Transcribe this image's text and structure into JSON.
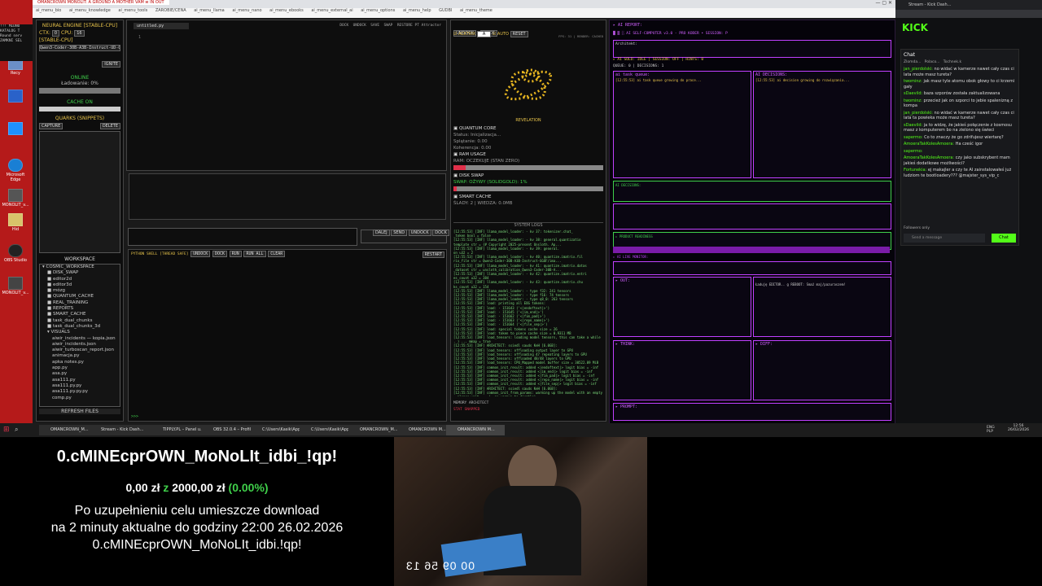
{
  "browser": {
    "tab_title": "OMANCROWN MONOLIT: A GROUND A MOTHER VAM w IN OUT",
    "bookmarks": [
      "ai_menu_bio",
      "ai_menu_knowledge",
      "ai_menu_tools",
      "ZAROBIE/CENA",
      "ai_menu_llama",
      "ai_menu_nano",
      "ai_menu_ebooks",
      "ai_menu_external_ai",
      "ai_menu_options",
      "ai_menu_help",
      "GUDBI",
      "ai_menu_theme"
    ]
  },
  "desktop_icons": [
    "Recy",
    "",
    "",
    "Microsoft Edge",
    "MONOLIT_v...",
    "Hid",
    "OBS Studio",
    "MONOLIT_v..."
  ],
  "left_app": {
    "engine_title": "NEURAL ENGINE [STABLE-CPU]",
    "ctx_label": "CTX:",
    "ctx_value": "0",
    "cpu_label": "CPU:",
    "cpu_value": "16",
    "stable_label": "[STABLE-CPU]",
    "model": "Qwen3-Coder-30B-A3B-Instruct-UD-Q8",
    "ignite": "IGNITE",
    "status": "ONLINE",
    "loading": "Ładowanie: 0%",
    "cache": "CACHE ON",
    "quarks_title": "QUARKS (SNIPPETS)",
    "capture": "CAPTURE",
    "delete": "DELETE",
    "workspace_title": "WORKSPACE",
    "workspace_items": [
      "▾ COSMIC_WORKSPACE",
      "■ DISK_SWAP",
      "■ editor2d",
      "■ editor3d",
      "■ mózg",
      "■ QUANTUM_CACHE",
      "■ REAL_TRAINING",
      "■ REPORTS",
      "■ SMART_CACHE",
      "■ task_dual_chunks",
      "■ task_dual_chunks_3d",
      "▾ VISUALS",
      "aiwir_incidents — kopia.json",
      "aiwir_incidents.json",
      "aiwir_turboscan_report.json",
      "animacja.py",
      "apka notes.py",
      "app.py",
      "asa.py",
      "asa111.py",
      "asa111.py.py",
      "asa111.py.py.py",
      "comp.py"
    ],
    "refresh": "REFRESH FILES",
    "left_text": [
      "!!! MIDNO",
      "KATALOG T",
      "Round serv",
      "ZAMKNI SEL"
    ]
  },
  "editor": {
    "tab": "untitled.py",
    "toolbar": [
      "DOCK",
      "UNDOCK",
      "SAVE",
      "SWAP",
      "RESTORE PT Attractor"
    ],
    "shell_title": "PYTHON SHELL [THREAD SAFE]",
    "shell_btns": [
      "UNDOCK",
      "DOCK",
      "RUN",
      "RUN ALL",
      "CLEAR"
    ],
    "shell_restart": "RESTART",
    "prompt": ">>>",
    "nav_btns": [
      "DALEJ",
      "SEND",
      "UNDOCK",
      "DOCK"
    ]
  },
  "middle": {
    "undock": "UNDOCK",
    "dock": "DOCK",
    "acktrix": "ACKTRIX",
    "acktrix_val": "A",
    "auto": "AUTO",
    "reset": "RESET",
    "fps": "FPS: 31 | RENDER: CACHED",
    "revelation": "REVELATION",
    "quantum_core": "QUANTUM CORE",
    "status_init": "Status: Inicjalizacja...",
    "entangle": "Splątanie: 0.00",
    "coherence": "Koherencja: 0.00",
    "ram_title": "RAM USAGE",
    "ram_status": "RAM: OCZEKUJE (STAN ZERO)",
    "disk_title": "DISK SWAP",
    "disk_status": "SWAP: OŻYWY (SOLIDGOLD): 1%",
    "smart_title": "SMART CACHE",
    "smart_status": "ŚLADY: 2 | WIEDZA: 0.0MB",
    "syslogs": "SYSTEM LOGS",
    "memory": "MEMORY ARCHITECT",
    "memory_sub": "STAT  SNAPPED",
    "log_lines": [
      "[12:55:53] [INF] llama_model_loader: - kv  37:                tokenizer.chat_",
      "_token bool     = false",
      "[12:55:53] [INF] llama_model_loader: - kv  38:           general.quantizatio",
      "template str    = {# Copyright 2025-present Unsloth. Ap...",
      "[12:55:53] [INF] llama_model_loader: - kv  39:                    general.",
      "on u32          = 2",
      "[12:55:53] [INF] llama_model_loader: - kv  40:      quantize.imatrix.fil",
      "rix_file str    = Qwen3-Coder-30B-A3B-Instruct-GGUF/ima...",
      "[12:55:53] [INF] llama_model_loader: - kv  41:  quantize.imatrix.datas",
      "_dataset str    = unsloth_calibration_Qwen3-Coder-30B-A...",
      "[12:55:53] [INF] llama_model_loader: - kv  42:  quantize.imatrix.entri",
      "es_count u32    = 384",
      "[12:55:53] [INF] llama_model_loader: - kv  43:   quantize.imatrix.chu",
      "ks_count u32    = 154",
      "[12:55:53] [INF] llama_model_loader: - type  f32:  241 tensors",
      "[12:55:53] [INF] llama_model_loader: - type  f16:   74 tensors",
      "[12:55:53] [INF] llama_model_loader: - type q8_0:  263 tensors",
      "[12:55:53] [INF] load: printing all EOG tokens:",
      "[12:55:53] [INF] load:   - 151643 ('<|endoftext|>')",
      "[12:55:53] [INF] load:   - 151645 ('<|im_end|>')",
      "[12:55:53] [INF] load:   - 151662 ('<|fim_pad|>')",
      "[12:55:53] [INF] load:   - 151663 ('<|repo_name|>')",
      "[12:55:53] [INF] load:   - 151664 ('<|file_sep|>')",
      "[12:55:53] [INF] load: special tokens cache size = 26",
      "[12:55:53] [INF] load: token to piece cache size = 0.9311 MB",
      "[12:55:53] [INF] load_tensors: loading model tensors, this can take a while",
      ". ) ... mmap = true",
      "[12:55:53] [INF] ARCHITECT: ssiedl sauds KeH [6.0GB]:",
      "[12:55:53] [INF] load_tensors: offloading output layer to GPU",
      "[12:55:53] [INF] load_tensors: offloading 47 repeating layers to GPU",
      "[12:55:53] [INF] load_tensors: offloaded 48/48 layers to GPU",
      "[12:55:53] [INF] load_tensors:    CPU_Mapped model buffer size = 30522.09 MiB",
      "[12:55:53] [INF] common_init_result: added <|endoftext|> logit bias = -inf",
      "[12:55:53] [INF] common_init_result: added <|im_end|> logit bias = -inf",
      "[12:55:53] [INF] common_init_result: added <|fim_pad|> logit bias = -inf",
      "[12:55:53] [INF] common_init_result: added <|repo_name|> logit bias = -inf",
      "[12:55:53] [INF] common_init_result: added <|file_sep|> logit bias = -inf",
      "[12:55:53] [INF] ARCHITECT: ssiedl sauds KeH [6.0GB]:",
      "[12:55:53] [INF] common_init_from_params: warming up the model with an empty run",
      " - please wait ... (--no-warmup to disable)",
      "[12:55:53] [INF] ARCHITECT: ssiedl sauds KeH [6.0GB]:"
    ]
  },
  "purple_app": {
    "header": "▸ AI REPORT:",
    "title": "▓ ▒ ░ AI SELF-COMPUTER v3.0 - PRO KODER • SESSION: P",
    "architect": "Architekt:",
    "status_line": "▸ AI SOLO: IDLE | SESSION: OFF | HINTS: 0",
    "queue": "QUEUE: 0 | DECISIONS: 1",
    "left_panel": "ai task queue:",
    "right_panel": "AI DECISIONS:",
    "left_entry": "[12:55:53] ai task queue growing do prace...",
    "right_entry": "[12:55:53] ai decision growing do rozwiązania...",
    "decision_panel": "AI DECISIONS:",
    "memory_panel": "▸ PRODUCT READINESS",
    "snapshot": "FINANCE: 0 pts | EXPIRED: 0 | CTX: SUSPENDED",
    "monitor": "▸ AI LIVE MONITOR:",
    "ai_out": "▸ OUT:",
    "err_out": "▸ ERR:",
    "diff_label": "▸ DIFF:",
    "thinking": "▸ THINK:",
    "agent_text": "Ładuję EDITOR.. g REBOOT: Smaż maj/pazuraszem!",
    "bottom": "▸ PROMPT:"
  },
  "kick": {
    "tab": "Stream - Kick Dash...",
    "logo": "KICK",
    "chat_title": "Chat",
    "chat_tabs": [
      "Zlomda...",
      "Polaco...",
      "Tochnek.k"
    ],
    "messages": [
      {
        "user": "jan_pierdolski:",
        "text": "no widać w kamerze nawet cały czas ci lata może masz tureta?"
      },
      {
        "user": "twominz:",
        "text": "jak masz tyle atomu obok głowy to ci krzemi gały"
      },
      {
        "user": "sDaevild:",
        "text": "baza szporów została zaktualizowana"
      },
      {
        "user": "twominz:",
        "text": "przecież jak on szporci to jebie spalenizną z kompa"
      },
      {
        "user": "jan_pierdolski:",
        "text": "no widać w kamerze nawet cały czas ci lata ta powieka może masz tureta?"
      },
      {
        "user": "sDaevild:",
        "text": "ja to widzę, że jakieś połączenie z kosmosu masz z komputerem bo na zielono się świeci"
      },
      {
        "user": "sapermo:",
        "text": "Co to znaczy że go zdrifujesz wiertarę?"
      },
      {
        "user": "AmoeraTakKolesAmoera:",
        "text": "Ha cześć igor"
      },
      {
        "user": "sapermo:",
        "text": ""
      },
      {
        "user": "AmoeraTakKolesAmoera:",
        "text": "czy jako subskrybent mam jakieś dodatkowe możliwości?"
      },
      {
        "user": "Fortunekia:",
        "text": "ej makajler a czy te AI zainstalowałeś już ludziom te bootloadery??? @majster_sys_vip_c"
      }
    ],
    "followers": "Followers only",
    "send_placeholder": "Send a message",
    "chat_btn": "Chat"
  },
  "taskbar": {
    "items": [
      "OMANCROWN_M...",
      "Stream - Kick Dash...",
      "TIPPLY.PL – Panel u...",
      "OBS 32.0.4 – Profile...",
      "C:\\Users\\Kasik\\App...",
      "C:\\Users\\Kasik\\App...",
      "OMANCROWN_M...",
      "OMANCROWN M...",
      "OMANCROWN M..."
    ],
    "lang": "ENG PLP",
    "time": "12:56",
    "date": "26/02/2026"
  },
  "overlay": {
    "title": "0.cMINEcprOWN_MoNoLIt_idbi_!qp!",
    "progress_current": "0,00 zł",
    "progress_z": "z",
    "progress_goal": "2000,00 zł",
    "progress_pct": "(0.00%)",
    "line1": "Po uzupełnieniu celu umieszcze download",
    "line2": "na 2 minuty aktualne do godziny 22:00 26.02.2026",
    "line3": "0.cMINEcprOWN_MoNoLIt_idbi.!qp!",
    "cam_timer": "00 09 56 13"
  },
  "colors": {
    "accent": "#e6c24a",
    "green": "#3fcf4a",
    "purple": "#c040ff",
    "kick": "#53fc18",
    "desktop": "#b51a1a"
  }
}
